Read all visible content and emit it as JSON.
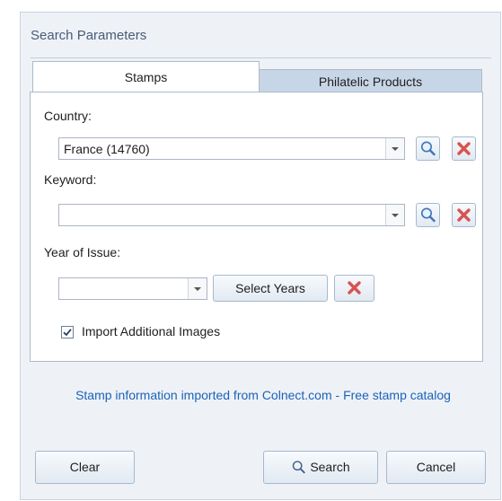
{
  "panel": {
    "title": "Search Parameters"
  },
  "tabs": [
    {
      "label": "Stamps",
      "active": true
    },
    {
      "label": "Philatelic Products",
      "active": false
    }
  ],
  "form": {
    "country_label": "Country:",
    "country_value": "France (14760)",
    "keyword_label": "Keyword:",
    "keyword_value": "",
    "year_label": "Year of Issue:",
    "year_value": "",
    "select_years_label": "Select Years",
    "import_images_label": "Import Additional Images",
    "import_images_checked": true
  },
  "info_text": "Stamp information imported from Colnect.com - Free stamp catalog",
  "footer": {
    "clear_label": "Clear",
    "search_label": "Search",
    "cancel_label": "Cancel"
  },
  "icons": {
    "search": "magnifier-icon",
    "clear": "red-x-icon",
    "dropdown": "chevron-down-icon",
    "check": "checkmark-icon"
  },
  "colors": {
    "panel_bg": "#eef2f7",
    "inactive_tab": "#c7d6e7",
    "link_text": "#1c62b8",
    "clear_x": "#d9534f"
  }
}
